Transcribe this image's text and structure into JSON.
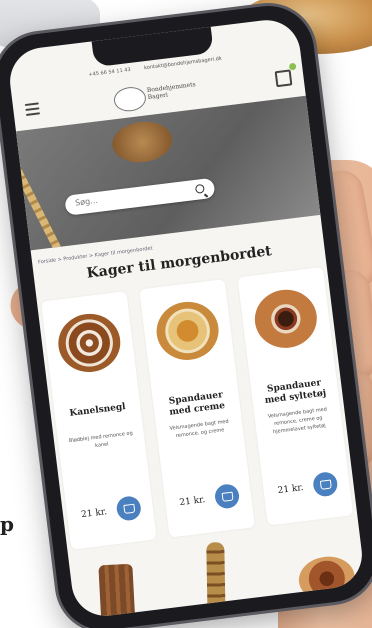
{
  "contact": {
    "phone": "+45 66 54 11 43",
    "email": "kontakt@bondehjemsbageri.dk"
  },
  "brand": {
    "name_line1": "Bondehjemmets",
    "name_line2": "Bageri"
  },
  "search": {
    "placeholder": "Søg..."
  },
  "breadcrumb": "Forside > Produkter > Kager til morgenbordet",
  "page_title": "Kager til morgenbordet",
  "products": [
    {
      "name": "Kanelsnegl",
      "description": "Blødblej med remonce og kanel",
      "price": "21 kr."
    },
    {
      "name": "Spandauer med creme",
      "description": "Velsmagende bagt med remonce, og creme",
      "price": "21 kr."
    },
    {
      "name": "Spandauer med syltetøj",
      "description": "Velsmagende bagt med remonce, creme og hjemmelavet syltetøj",
      "price": "21 kr."
    }
  ],
  "background_text": "p",
  "colors": {
    "accent": "#4a7fc0",
    "cart_badge": "#8bbf4e"
  }
}
